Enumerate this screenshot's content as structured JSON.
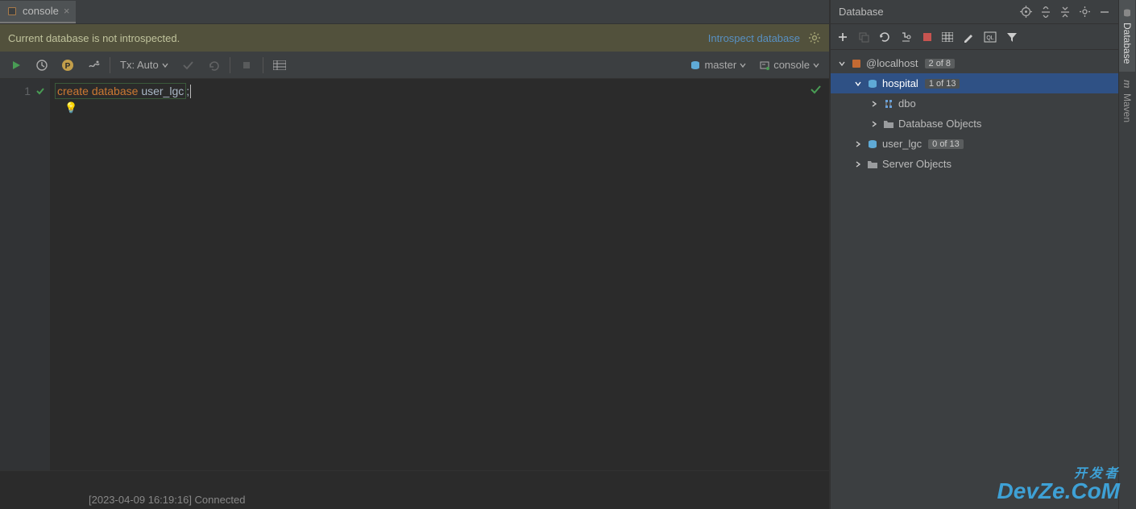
{
  "tab": {
    "label": "console"
  },
  "banner": {
    "text": "Current database is not introspected.",
    "link": "Introspect database"
  },
  "toolbar": {
    "tx_label": "Tx: Auto",
    "target_db": "master",
    "session": "console"
  },
  "code": {
    "line_number": "1",
    "keyword1": "create",
    "keyword2": "database",
    "identifier": "user_lgc",
    "terminator": ";"
  },
  "log": {
    "text": "[2023-04-09 16:19:16] Connected"
  },
  "db_panel": {
    "title": "Database",
    "root": {
      "label": "@localhost",
      "count": "2 of 8"
    },
    "hospital": {
      "label": "hospital",
      "count": "1 of 13"
    },
    "dbo": {
      "label": "dbo"
    },
    "db_objects": {
      "label": "Database Objects"
    },
    "user_lgc": {
      "label": "user_lgc",
      "count": "0 of 13"
    },
    "server_objects": {
      "label": "Server Objects"
    }
  },
  "railtabs": {
    "database": "Database",
    "maven": "Maven"
  }
}
